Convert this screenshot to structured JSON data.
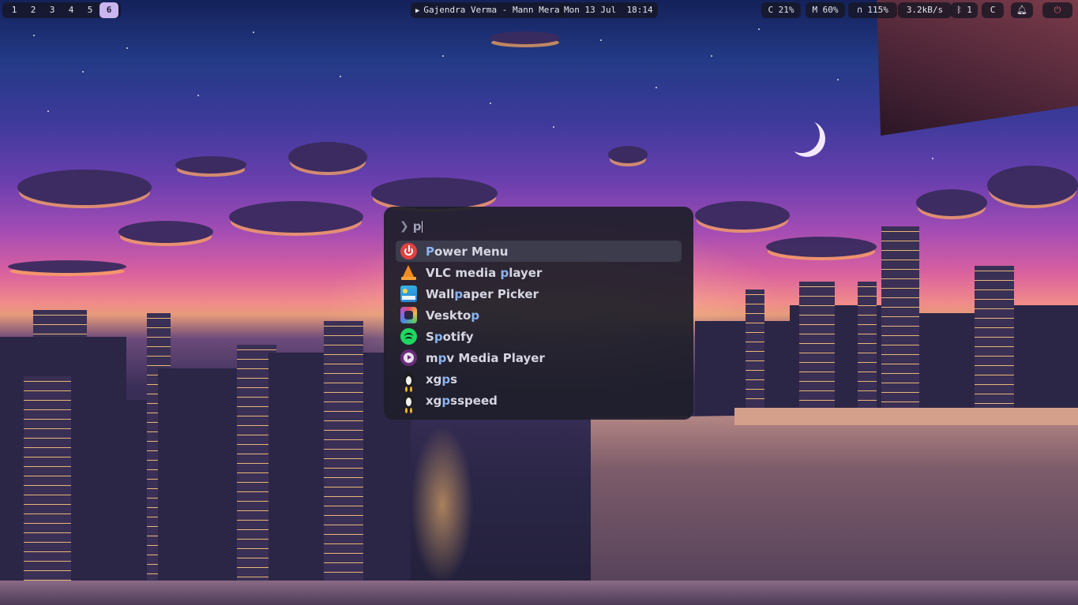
{
  "topbar": {
    "workspaces": [
      "1",
      "2",
      "3",
      "4",
      "5",
      "6"
    ],
    "active_workspace": "6",
    "media": {
      "icon": "play-icon",
      "title": "Gajendra Verma - Mann Mera"
    },
    "clock": {
      "date": "Mon 13 Jul",
      "time": "18:14"
    },
    "cpu": "C 21%",
    "memory": "M 60%",
    "volume": "115%",
    "network": "3.2kB/s",
    "bluetooth": "1",
    "caffeine": "C",
    "icons": {
      "volume": "headphones-icon",
      "bluetooth": "bluetooth-icon",
      "notification": "bell-icon",
      "power": "power-icon"
    },
    "power_color": "#e26073",
    "active_workspace_color": "#c9b5ef"
  },
  "launcher": {
    "prompt_icon": "chevron-right-icon",
    "query": "p",
    "results": [
      {
        "pre": "",
        "match": "P",
        "post": "ower Menu",
        "icon": "power-icon",
        "selected": true
      },
      {
        "pre": "VLC media ",
        "match": "p",
        "post": "layer",
        "icon": "vlc-cone-icon"
      },
      {
        "pre": "Wall",
        "match": "p",
        "post": "aper Picker",
        "icon": "wallpaper-picker-icon"
      },
      {
        "pre": "Veskto",
        "match": "p",
        "post": "",
        "icon": "vesktop-icon"
      },
      {
        "pre": "S",
        "match": "p",
        "post": "otify",
        "icon": "spotify-icon"
      },
      {
        "pre": "m",
        "match": "p",
        "post": "v Media Player",
        "icon": "mpv-icon"
      },
      {
        "pre": "xg",
        "match": "p",
        "post": "s",
        "icon": "tux-icon"
      },
      {
        "pre": "xg",
        "match": "p",
        "post": "sspeed",
        "icon": "tux-icon"
      }
    ],
    "highlight_color": "#8ab4f0"
  }
}
